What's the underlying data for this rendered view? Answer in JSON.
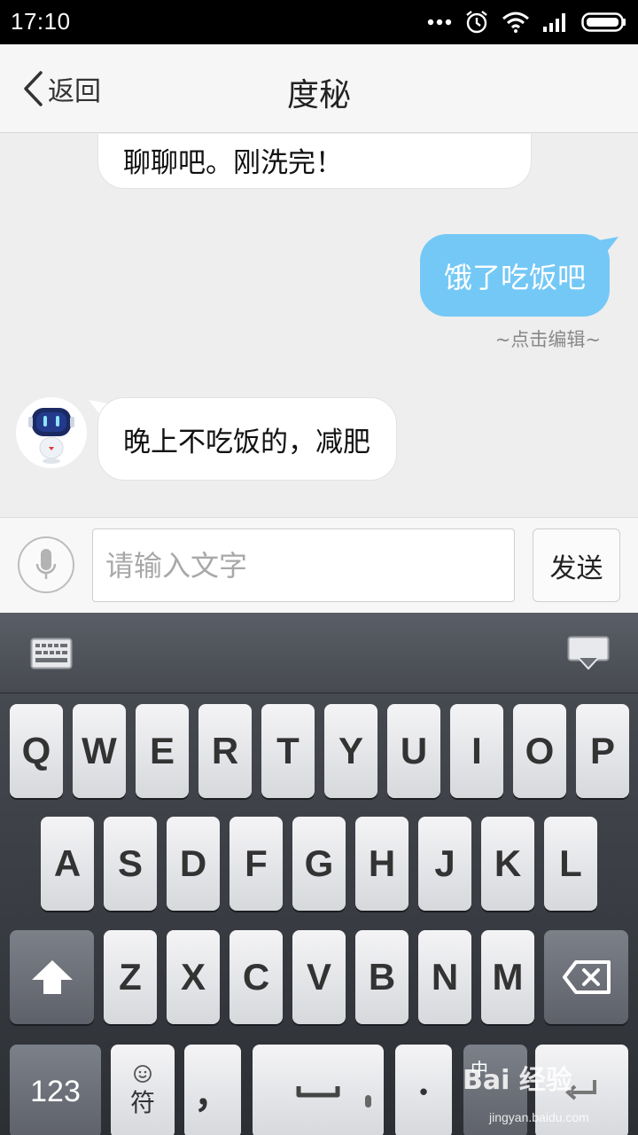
{
  "status_bar": {
    "time": "17:10"
  },
  "header": {
    "back_label": "返回",
    "title": "度秘"
  },
  "messages": {
    "prev_bot": "聊聊吧。刚洗完！",
    "user": "饿了吃饭吧",
    "edit_hint": "~点击编辑~",
    "bot": "晚上不吃饭的，减肥"
  },
  "input": {
    "placeholder": "请输入文字",
    "value": "",
    "send_label": "发送"
  },
  "keyboard": {
    "row1": [
      "Q",
      "W",
      "E",
      "R",
      "T",
      "Y",
      "U",
      "I",
      "O",
      "P"
    ],
    "row2": [
      "A",
      "S",
      "D",
      "F",
      "G",
      "H",
      "J",
      "K",
      "L"
    ],
    "row3": [
      "Z",
      "X",
      "C",
      "V",
      "B",
      "N",
      "M"
    ],
    "num_label": "123",
    "symbol_label": "符",
    "comma_label": "，",
    "period_label": "•",
    "lang_label": "中"
  },
  "watermark": {
    "text": "Bai 经验",
    "url": "jingyan.baidu.com"
  },
  "colors": {
    "user_bubble": "#74c8f6",
    "status_bar": "#000000"
  }
}
